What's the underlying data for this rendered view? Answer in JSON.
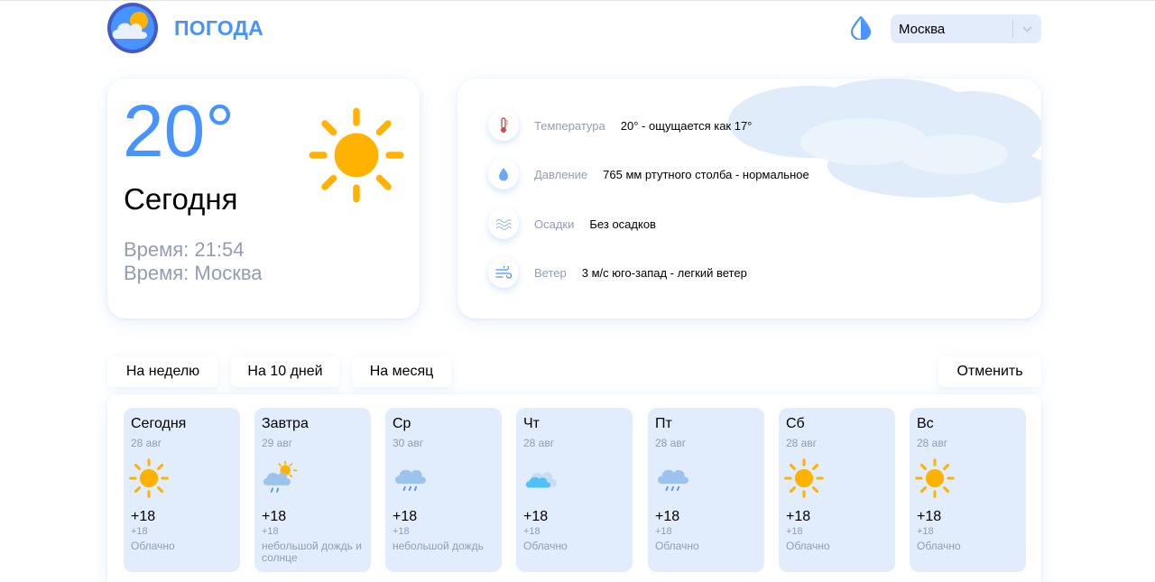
{
  "header": {
    "brand": "ПОГОДА",
    "city": "Москва"
  },
  "today": {
    "temperature": "20°",
    "label": "Сегодня",
    "time": "Время: 21:54",
    "city": "Время: Москва"
  },
  "details": [
    {
      "icon": "thermometer-icon",
      "label": "Температура",
      "value": "20° - ощущается как 17°"
    },
    {
      "icon": "pressure-drop-icon",
      "label": "Давление",
      "value": "765 мм ртутного столба - нормальное"
    },
    {
      "icon": "precipitation-icon",
      "label": "Осадки",
      "value": "Без осадков"
    },
    {
      "icon": "wind-icon",
      "label": "Ветер",
      "value": "3 м/с юго-запад - легкий ветер"
    }
  ],
  "tabs": {
    "week": "На неделю",
    "ten_days": "На 10 дней",
    "month": "На месяц",
    "cancel": "Отменить"
  },
  "forecast": [
    {
      "day": "Сегодня",
      "date": "28 авг",
      "icon": "sun-icon",
      "temp": "+18",
      "feels": "+18",
      "desc": "Облачно"
    },
    {
      "day": "Завтра",
      "date": "29 авг",
      "icon": "sun-rain-icon",
      "temp": "+18",
      "feels": "+18",
      "desc": "небольшой дождь и солнце"
    },
    {
      "day": "Ср",
      "date": "30 авг",
      "icon": "rain-cloud-icon",
      "temp": "+18",
      "feels": "+18",
      "desc": "небольшой дождь"
    },
    {
      "day": "Чт",
      "date": "28 авг",
      "icon": "cloud-icon",
      "temp": "+18",
      "feels": "+18",
      "desc": "Облачно"
    },
    {
      "day": "Пт",
      "date": "28 авг",
      "icon": "rain-cloud-icon",
      "temp": "+18",
      "feels": "+18",
      "desc": "Облачно"
    },
    {
      "day": "Сб",
      "date": "28 авг",
      "icon": "sun-icon",
      "temp": "+18",
      "feels": "+18",
      "desc": "Облачно"
    },
    {
      "day": "Вс",
      "date": "28 авг",
      "icon": "sun-icon",
      "temp": "+18",
      "feels": "+18",
      "desc": "Облачно"
    }
  ],
  "colors": {
    "accent": "#4793ff",
    "muted_text": "#939cb0",
    "card_blue": "#e1ecfc",
    "sun": "#ffb300"
  }
}
